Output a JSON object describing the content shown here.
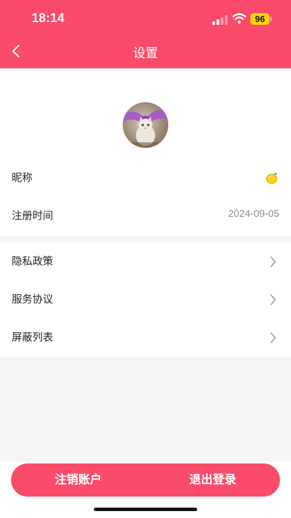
{
  "status_bar": {
    "time": "18:14",
    "battery": "96"
  },
  "header": {
    "title": "设置",
    "back_icon": "chevron-left-icon"
  },
  "profile": {
    "avatar_icon": "avatar-cat-photo"
  },
  "account_rows": [
    {
      "label": "昵称",
      "icon": "lemon-icon"
    },
    {
      "label": "注册时间",
      "value": "2024-09-05"
    }
  ],
  "menu_rows": [
    {
      "label": "隐私政策",
      "icon": "chevron-right-icon"
    },
    {
      "label": "服务协议",
      "icon": "chevron-right-icon"
    },
    {
      "label": "屏蔽列表",
      "icon": "chevron-right-icon"
    }
  ],
  "bottom_buttons": {
    "delete_account": "注销账户",
    "logout": "退出登录"
  },
  "colors": {
    "accent": "#fb4b6a",
    "page_background": "#f5f5f5",
    "card_background": "#ffffff",
    "secondary_text": "#8e8e8e",
    "battery_badge": "#ffd60a"
  }
}
